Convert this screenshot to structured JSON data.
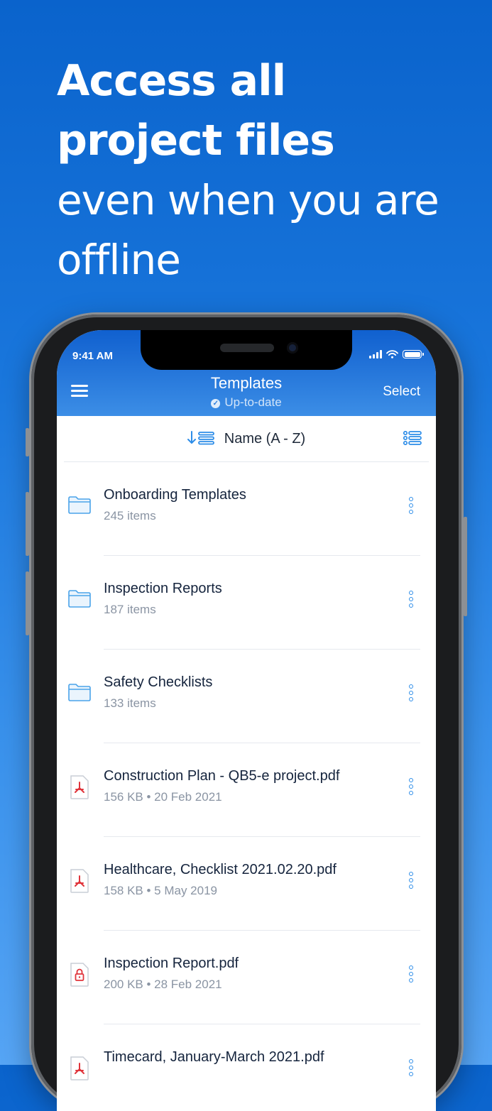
{
  "headline": {
    "line1": "Access all",
    "line2": "project files",
    "line3": "even when you are",
    "line4": "offline"
  },
  "status_bar": {
    "time": "9:41 AM",
    "icons": [
      "cellular-signal-icon",
      "wifi-icon",
      "battery-icon"
    ]
  },
  "nav": {
    "menu_icon": "hamburger-menu-icon",
    "title": "Templates",
    "subtitle": "Up-to-date",
    "select_label": "Select"
  },
  "sort": {
    "label": "Name (A - Z)",
    "sort_icon": "sort-descending-icon",
    "view_icon": "list-view-icon"
  },
  "items": [
    {
      "name": "Onboarding Templates",
      "meta": "245 items",
      "type": "folder"
    },
    {
      "name": "Inspection Reports",
      "meta": "187 items",
      "type": "folder"
    },
    {
      "name": "Safety Checklists",
      "meta": "133 items",
      "type": "folder"
    },
    {
      "name": "Construction Plan - QB5-e project.pdf",
      "meta": "156 KB • 20 Feb 2021",
      "type": "pdf"
    },
    {
      "name": "Healthcare, Checklist 2021.02.20.pdf",
      "meta": "158 KB • 5 May 2019",
      "type": "pdf"
    },
    {
      "name": "Inspection Report.pdf",
      "meta": "200 KB • 28 Feb 2021",
      "type": "locked-pdf"
    },
    {
      "name": "Timecard, January-March 2021.pdf",
      "meta": "",
      "type": "pdf"
    }
  ],
  "colors": {
    "accent": "#2d8de8",
    "pdf_red": "#e0343b",
    "folder_blue": "#4aa3ea"
  }
}
